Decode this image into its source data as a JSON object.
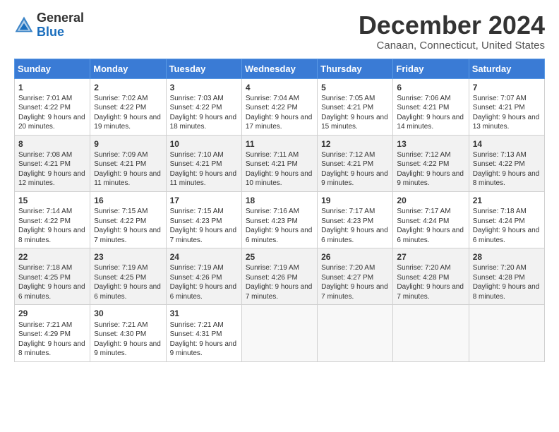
{
  "logo": {
    "line1": "General",
    "line2": "Blue"
  },
  "title": "December 2024",
  "subtitle": "Canaan, Connecticut, United States",
  "days_of_week": [
    "Sunday",
    "Monday",
    "Tuesday",
    "Wednesday",
    "Thursday",
    "Friday",
    "Saturday"
  ],
  "weeks": [
    [
      {
        "day": 1,
        "sunrise": "7:01 AM",
        "sunset": "4:22 PM",
        "daylight": "9 hours and 20 minutes."
      },
      {
        "day": 2,
        "sunrise": "7:02 AM",
        "sunset": "4:22 PM",
        "daylight": "9 hours and 19 minutes."
      },
      {
        "day": 3,
        "sunrise": "7:03 AM",
        "sunset": "4:22 PM",
        "daylight": "9 hours and 18 minutes."
      },
      {
        "day": 4,
        "sunrise": "7:04 AM",
        "sunset": "4:22 PM",
        "daylight": "9 hours and 17 minutes."
      },
      {
        "day": 5,
        "sunrise": "7:05 AM",
        "sunset": "4:21 PM",
        "daylight": "9 hours and 15 minutes."
      },
      {
        "day": 6,
        "sunrise": "7:06 AM",
        "sunset": "4:21 PM",
        "daylight": "9 hours and 14 minutes."
      },
      {
        "day": 7,
        "sunrise": "7:07 AM",
        "sunset": "4:21 PM",
        "daylight": "9 hours and 13 minutes."
      }
    ],
    [
      {
        "day": 8,
        "sunrise": "7:08 AM",
        "sunset": "4:21 PM",
        "daylight": "9 hours and 12 minutes."
      },
      {
        "day": 9,
        "sunrise": "7:09 AM",
        "sunset": "4:21 PM",
        "daylight": "9 hours and 11 minutes."
      },
      {
        "day": 10,
        "sunrise": "7:10 AM",
        "sunset": "4:21 PM",
        "daylight": "9 hours and 11 minutes."
      },
      {
        "day": 11,
        "sunrise": "7:11 AM",
        "sunset": "4:21 PM",
        "daylight": "9 hours and 10 minutes."
      },
      {
        "day": 12,
        "sunrise": "7:12 AM",
        "sunset": "4:21 PM",
        "daylight": "9 hours and 9 minutes."
      },
      {
        "day": 13,
        "sunrise": "7:12 AM",
        "sunset": "4:22 PM",
        "daylight": "9 hours and 9 minutes."
      },
      {
        "day": 14,
        "sunrise": "7:13 AM",
        "sunset": "4:22 PM",
        "daylight": "9 hours and 8 minutes."
      }
    ],
    [
      {
        "day": 15,
        "sunrise": "7:14 AM",
        "sunset": "4:22 PM",
        "daylight": "9 hours and 8 minutes."
      },
      {
        "day": 16,
        "sunrise": "7:15 AM",
        "sunset": "4:22 PM",
        "daylight": "9 hours and 7 minutes."
      },
      {
        "day": 17,
        "sunrise": "7:15 AM",
        "sunset": "4:23 PM",
        "daylight": "9 hours and 7 minutes."
      },
      {
        "day": 18,
        "sunrise": "7:16 AM",
        "sunset": "4:23 PM",
        "daylight": "9 hours and 6 minutes."
      },
      {
        "day": 19,
        "sunrise": "7:17 AM",
        "sunset": "4:23 PM",
        "daylight": "9 hours and 6 minutes."
      },
      {
        "day": 20,
        "sunrise": "7:17 AM",
        "sunset": "4:24 PM",
        "daylight": "9 hours and 6 minutes."
      },
      {
        "day": 21,
        "sunrise": "7:18 AM",
        "sunset": "4:24 PM",
        "daylight": "9 hours and 6 minutes."
      }
    ],
    [
      {
        "day": 22,
        "sunrise": "7:18 AM",
        "sunset": "4:25 PM",
        "daylight": "9 hours and 6 minutes."
      },
      {
        "day": 23,
        "sunrise": "7:19 AM",
        "sunset": "4:25 PM",
        "daylight": "9 hours and 6 minutes."
      },
      {
        "day": 24,
        "sunrise": "7:19 AM",
        "sunset": "4:26 PM",
        "daylight": "9 hours and 6 minutes."
      },
      {
        "day": 25,
        "sunrise": "7:19 AM",
        "sunset": "4:26 PM",
        "daylight": "9 hours and 7 minutes."
      },
      {
        "day": 26,
        "sunrise": "7:20 AM",
        "sunset": "4:27 PM",
        "daylight": "9 hours and 7 minutes."
      },
      {
        "day": 27,
        "sunrise": "7:20 AM",
        "sunset": "4:28 PM",
        "daylight": "9 hours and 7 minutes."
      },
      {
        "day": 28,
        "sunrise": "7:20 AM",
        "sunset": "4:28 PM",
        "daylight": "9 hours and 8 minutes."
      }
    ],
    [
      {
        "day": 29,
        "sunrise": "7:21 AM",
        "sunset": "4:29 PM",
        "daylight": "9 hours and 8 minutes."
      },
      {
        "day": 30,
        "sunrise": "7:21 AM",
        "sunset": "4:30 PM",
        "daylight": "9 hours and 9 minutes."
      },
      {
        "day": 31,
        "sunrise": "7:21 AM",
        "sunset": "4:31 PM",
        "daylight": "9 hours and 9 minutes."
      },
      null,
      null,
      null,
      null
    ]
  ],
  "labels": {
    "sunrise": "Sunrise:",
    "sunset": "Sunset:",
    "daylight": "Daylight:"
  }
}
